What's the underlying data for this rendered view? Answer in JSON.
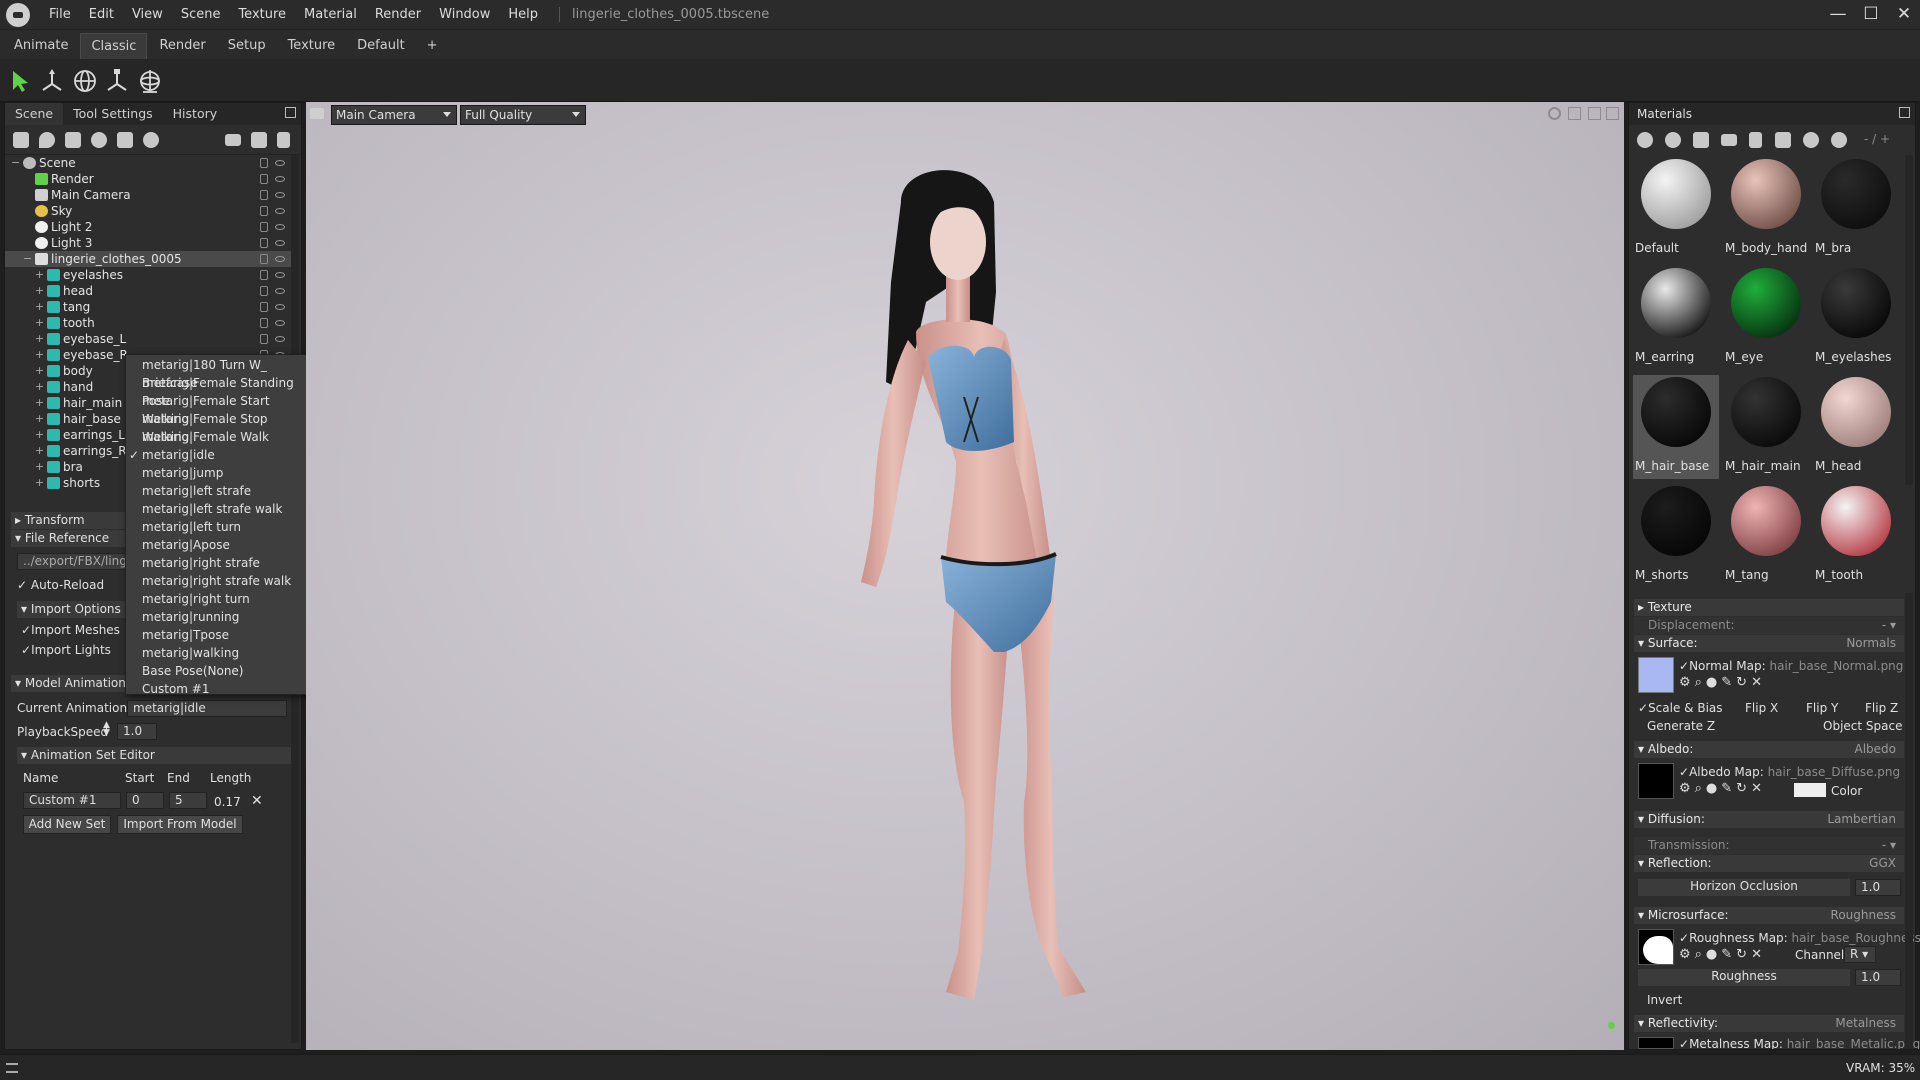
{
  "window": {
    "title": "lingerie_clothes_0005.tbscene",
    "menu": [
      "File",
      "Edit",
      "View",
      "Scene",
      "Texture",
      "Material",
      "Render",
      "Window",
      "Help"
    ],
    "controls": {
      "minimize": "—",
      "maximize": "☐",
      "close": "✕"
    }
  },
  "layout_tabs": [
    "Animate",
    "Classic",
    "Render",
    "Setup",
    "Texture",
    "Default",
    "+"
  ],
  "active_layout_tab": "Classic",
  "toolbar": {
    "tools": [
      "select-arrow-icon",
      "move-gizmo-icon",
      "rotate-gizmo-icon",
      "scale-gizmo-icon",
      "light-gizmo-icon"
    ]
  },
  "left_panel": {
    "tabs": [
      "Scene",
      "Tool Settings",
      "History"
    ],
    "active_tab": "Scene",
    "tree": [
      {
        "label": "Scene",
        "icon": "scene"
      },
      {
        "label": "Render",
        "icon": "render"
      },
      {
        "label": "Main Camera",
        "icon": "camera"
      },
      {
        "label": "Sky",
        "icon": "sky"
      },
      {
        "label": "Light 2",
        "icon": "light"
      },
      {
        "label": "Light 3",
        "icon": "light"
      },
      {
        "label": "lingerie_clothes_0005",
        "icon": "model",
        "selected": true
      },
      {
        "label": "eyelashes",
        "icon": "mesh"
      },
      {
        "label": "head",
        "icon": "mesh"
      },
      {
        "label": "tang",
        "icon": "mesh"
      },
      {
        "label": "tooth",
        "icon": "mesh"
      },
      {
        "label": "eyebase_L",
        "icon": "mesh"
      },
      {
        "label": "eyebase_R",
        "icon": "mesh"
      },
      {
        "label": "body",
        "icon": "mesh"
      },
      {
        "label": "hand",
        "icon": "mesh"
      },
      {
        "label": "hair_main",
        "icon": "mesh"
      },
      {
        "label": "hair_base",
        "icon": "mesh"
      },
      {
        "label": "earrings_L",
        "icon": "mesh"
      },
      {
        "label": "earrings_R",
        "icon": "mesh"
      },
      {
        "label": "bra",
        "icon": "mesh"
      },
      {
        "label": "shorts",
        "icon": "mesh"
      }
    ],
    "sections": {
      "transform": "Transform",
      "file_reference": "File Reference",
      "file_path": "../export/FBX/linger",
      "auto_reload": "Auto-Reload",
      "import_options": "Import Options",
      "import_meshes": "Import Meshes",
      "import_lights": "Import Lights",
      "model_animation": "Model Animation",
      "current_animation_label": "Current Animation:",
      "current_animation_value": "metarig|idle",
      "playback_speed_label": "PlaybackSpeed",
      "playback_speed_value": "1.0",
      "anim_set_editor": "Animation Set Editor",
      "cols": {
        "name": "Name",
        "start": "Start",
        "end": "End",
        "length": "Length"
      },
      "set_row": {
        "name": "Custom #1",
        "start": "0",
        "end": "5",
        "length": "0.17"
      },
      "add_new_set": "Add New Set",
      "import_from_model": "Import From Model"
    }
  },
  "animation_dropdown": {
    "items": [
      "metarig|180 Turn W_ Briefcase",
      "metarig|Female Standing Pose",
      "metarig|Female Start Walking",
      "metarig|Female Stop Walking",
      "metarig|Female Walk",
      "metarig|idle",
      "metarig|jump",
      "metarig|left strafe",
      "metarig|left strafe walk",
      "metarig|left turn",
      "metarig|Apose",
      "metarig|right strafe",
      "metarig|right strafe walk",
      "metarig|right turn",
      "metarig|running",
      "metarig|Tpose",
      "metarig|walking",
      "Base Pose(None)",
      "Custom #1"
    ],
    "checked": "metarig|idle",
    "check_mark": "✓"
  },
  "viewport": {
    "camera": "Main Camera",
    "quality": "Full Quality"
  },
  "materials_panel": {
    "title": "Materials",
    "page_indicator": "- / +",
    "materials": [
      {
        "name": "Default",
        "color_a": "#f4f4f4",
        "color_b": "#9a9a9a"
      },
      {
        "name": "M_body_hand",
        "color_a": "#e8c3b9",
        "color_b": "#6b4a44"
      },
      {
        "name": "M_bra",
        "color_a": "#2a2a2a",
        "color_b": "#0c0c0c"
      },
      {
        "name": "M_earring",
        "color_a": "#e9e9e9",
        "color_b": "#0a0a0a"
      },
      {
        "name": "M_eye",
        "color_a": "#1fae3b",
        "color_b": "#052a0e"
      },
      {
        "name": "M_eyelashes",
        "color_a": "#3a3a3a",
        "color_b": "#050505"
      },
      {
        "name": "M_hair_base",
        "color_a": "#2c2c2c",
        "color_b": "#050505",
        "selected": true
      },
      {
        "name": "M_hair_main",
        "color_a": "#333333",
        "color_b": "#070707"
      },
      {
        "name": "M_head",
        "color_a": "#f2d7d3",
        "color_b": "#9a7a76"
      },
      {
        "name": "M_shorts",
        "color_a": "#1c1c1c",
        "color_b": "#050505"
      },
      {
        "name": "M_tang",
        "color_a": "#f0b4b4",
        "color_b": "#7a3a3e"
      },
      {
        "name": "M_tooth",
        "color_a": "#f4f4f4",
        "color_b": "#b2323c"
      }
    ],
    "props": {
      "texture": "Texture",
      "displacement": "Displacement:",
      "surface": "Surface:",
      "surface_mode": "Normals",
      "normal_map_label": "Normal Map:",
      "normal_map_file": "hair_base_Normal.png",
      "scale_bias": "Scale & Bias",
      "flip_x": "Flip X",
      "flip_y": "Flip Y",
      "flip_z": "Flip Z",
      "generate_z": "Generate Z",
      "object_space": "Object Space",
      "albedo": "Albedo:",
      "albedo_mode": "Albedo",
      "albedo_map_label": "Albedo Map:",
      "albedo_map_file": "hair_base_Diffuse.png",
      "color_label": "Color",
      "diffusion": "Diffusion:",
      "diffusion_mode": "Lambertian",
      "transmission": "Transmission:",
      "reflection": "Reflection:",
      "reflection_mode": "GGX",
      "horizon_occlusion": "Horizon Occlusion",
      "horizon_value": "1.0",
      "microsurface": "Microsurface:",
      "microsurface_mode": "Roughness",
      "roughness_map_label": "Roughness Map:",
      "roughness_map_file": "hair_base_Roughness.p",
      "channel_label": "Channel",
      "channel_value": "R",
      "roughness_label": "Roughness",
      "roughness_value": "1.0",
      "invert": "Invert",
      "reflectivity": "Reflectivity:",
      "reflectivity_mode": "Metalness",
      "metalness_map_label": "Metalness Map:",
      "metalness_map_file": "hair_base_Metalic.png"
    }
  },
  "status": {
    "vram": "VRAM: 35%"
  },
  "colors": {
    "accent_green": "#5fd24a",
    "selection": "#4a4a4a",
    "panel": "#2d2d2d",
    "lingerie": "#5c8fbf"
  }
}
